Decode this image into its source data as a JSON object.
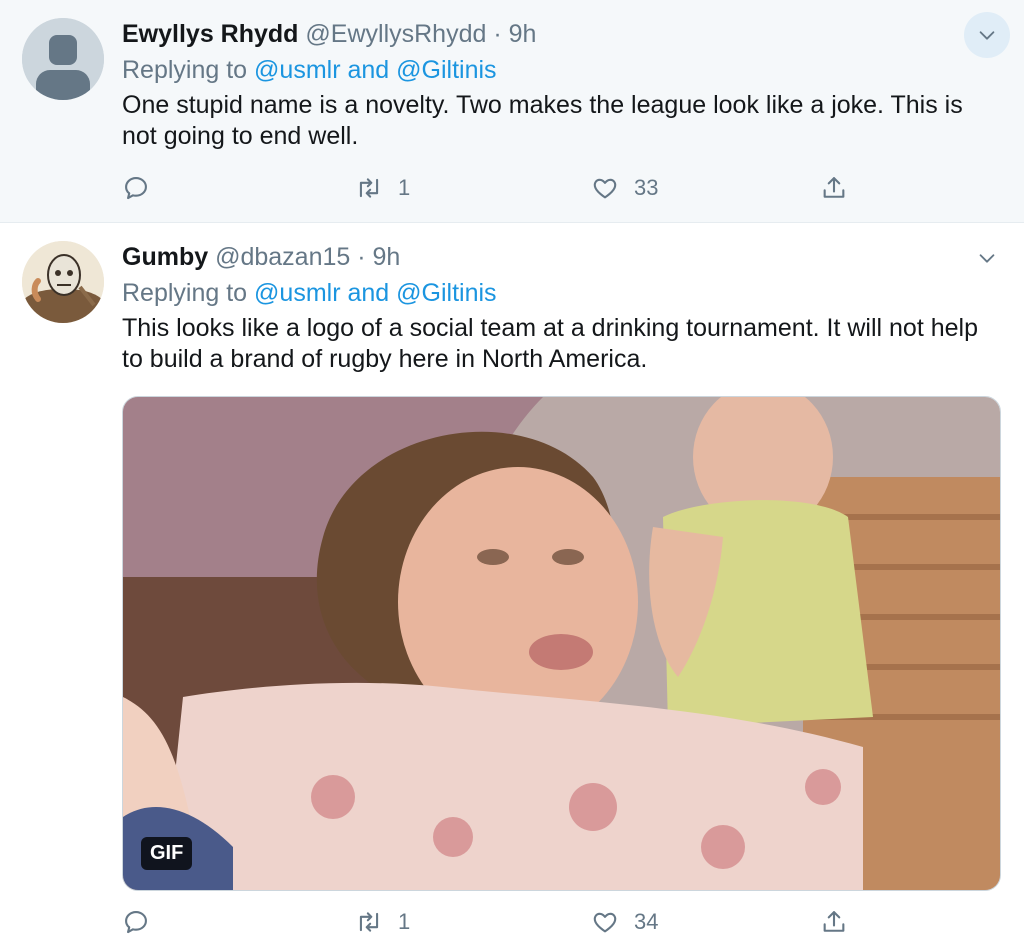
{
  "tweets": [
    {
      "name": "Ewyllys Rhydd",
      "handle": "@EwyllysRhydd",
      "separator": "·",
      "time": "9h",
      "replying_prefix": "Replying to",
      "mention1": "@usmlr",
      "and_word": "and",
      "mention2": "@Giltinis",
      "text": "One stupid name is a novelty. Two makes the league look like a joke. This is not going to end well.",
      "retweets": "1",
      "likes": "33"
    },
    {
      "name": "Gumby",
      "handle": "@dbazan15",
      "separator": "·",
      "time": "9h",
      "replying_prefix": "Replying to",
      "mention1": "@usmlr",
      "and_word": "and",
      "mention2": "@Giltinis",
      "text": "This looks like a logo of a social team at a drinking tournament. It will not help to build a brand of rugby here in North America.",
      "media_badge": "GIF",
      "retweets": "1",
      "likes": "34"
    }
  ],
  "icons": {
    "reply": "reply-icon",
    "retweet": "retweet-icon",
    "like": "heart-icon",
    "share": "share-icon",
    "caret": "chevron-down-icon"
  },
  "colors": {
    "accent": "#1b95e0",
    "secondary_text": "#657786",
    "highlight_bg": "#f5f8fa"
  }
}
